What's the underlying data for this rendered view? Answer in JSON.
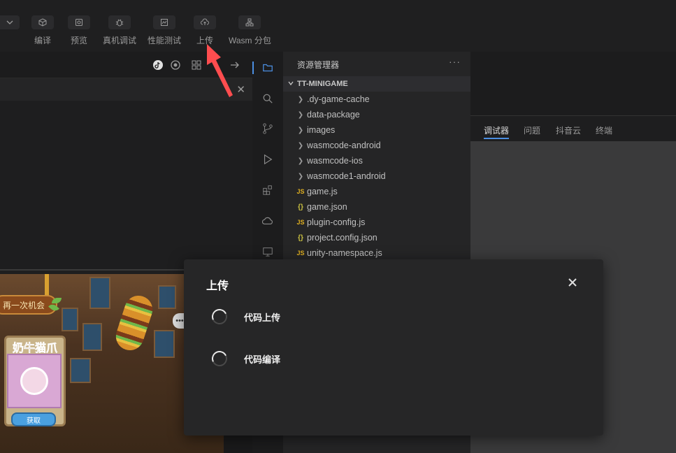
{
  "toolbar": {
    "items": [
      {
        "label": "编译",
        "icon": "cube-icon"
      },
      {
        "label": "预览",
        "icon": "preview-icon"
      },
      {
        "label": "真机调试",
        "icon": "bug-icon"
      },
      {
        "label": "性能测试",
        "icon": "performance-icon"
      },
      {
        "label": "上传",
        "icon": "cloud-upload-icon"
      },
      {
        "label": "Wasm 分包",
        "icon": "package-icon"
      }
    ]
  },
  "explorer": {
    "title": "资源管理器",
    "more": "···",
    "project": "TT-MINIGAME",
    "items": [
      {
        "name": ".dy-game-cache",
        "type": "folder"
      },
      {
        "name": "data-package",
        "type": "folder"
      },
      {
        "name": "images",
        "type": "folder"
      },
      {
        "name": "wasmcode-android",
        "type": "folder"
      },
      {
        "name": "wasmcode-ios",
        "type": "folder"
      },
      {
        "name": "wasmcode1-android",
        "type": "folder"
      },
      {
        "name": "game.js",
        "type": "js"
      },
      {
        "name": "game.json",
        "type": "json"
      },
      {
        "name": "plugin-config.js",
        "type": "js"
      },
      {
        "name": "project.config.json",
        "type": "json"
      },
      {
        "name": "unity-namespace.js",
        "type": "js"
      }
    ]
  },
  "icon_glyphs": {
    "folder": "❯",
    "js": "JS",
    "json": "{}"
  },
  "right_panel": {
    "tabs": [
      "调试器",
      "问题",
      "抖音云",
      "终端"
    ],
    "active_tab": 0
  },
  "game": {
    "sign_text": "再一次机会",
    "card_title": "奶牛猫爪",
    "get_button": "获取",
    "menu_dots": "•••"
  },
  "modal": {
    "title": "上传",
    "steps": [
      {
        "label": "代码上传",
        "status": "loading"
      },
      {
        "label": "代码编译",
        "status": "loading"
      }
    ]
  },
  "colors": {
    "accent": "#4b8fe2",
    "annotation_arrow": "#ff4d4f",
    "modal_bg": "#262627"
  }
}
